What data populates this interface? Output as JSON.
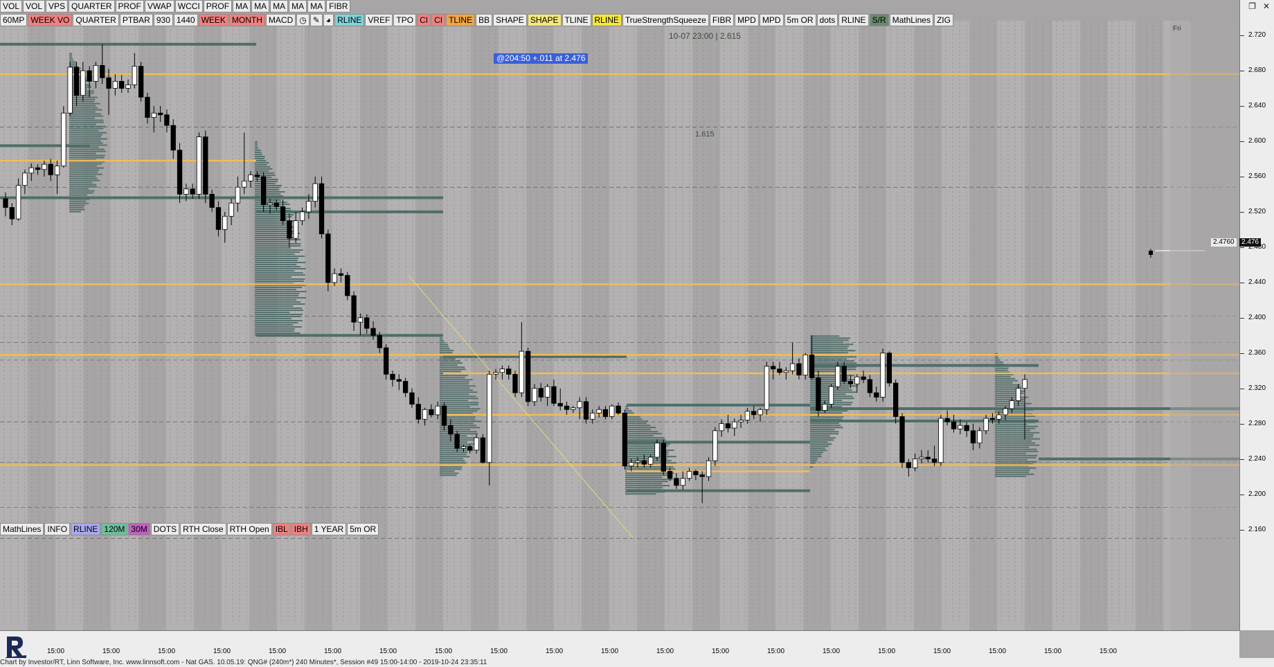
{
  "window": {
    "restore_glyph": "❐",
    "close_glyph": "✕"
  },
  "toolbar_row1": [
    "VOL",
    "VOL",
    "VPS",
    "QUARTER",
    "PROF",
    "VWAP",
    "WCCI",
    "PROF",
    "MA",
    "MA",
    "MA",
    "MA",
    "MA",
    "FIBR"
  ],
  "toolbar_row2": [
    {
      "label": "60MP",
      "color": "#ececec"
    },
    {
      "label": "WEEK VO",
      "color": "#f08080"
    },
    {
      "label": "QUARTER",
      "color": "#ececec"
    },
    {
      "label": "PTBAR",
      "color": "#ececec"
    },
    {
      "label": "930",
      "color": "#ececec"
    },
    {
      "label": "1440",
      "color": "#ececec"
    },
    {
      "label": "WEEK",
      "color": "#f08080"
    },
    {
      "label": "MONTH",
      "color": "#f08080"
    },
    {
      "label": "MACD",
      "color": "#ececec"
    },
    {
      "label": "◷",
      "color": "#ececec"
    },
    {
      "label": "✎",
      "color": "#ececec"
    },
    {
      "label": "◕",
      "color": "#ececec"
    },
    {
      "label": "RLINE",
      "color": "#7fd3d8"
    },
    {
      "label": "VREF",
      "color": "#ececec"
    },
    {
      "label": "TPO",
      "color": "#ececec"
    },
    {
      "label": "CI",
      "color": "#f08080"
    },
    {
      "label": "CI",
      "color": "#f08080"
    },
    {
      "label": "TLINE",
      "color": "#f2a640"
    },
    {
      "label": "BB",
      "color": "#ececec"
    },
    {
      "label": "SHAPE",
      "color": "#ececec"
    },
    {
      "label": "SHAPE",
      "color": "#f5e87a"
    },
    {
      "label": "TLINE",
      "color": "#ececec"
    },
    {
      "label": "RLINE",
      "color": "#f5e83a"
    },
    {
      "label": "TrueStrengthSqueeze",
      "color": "#ececec"
    },
    {
      "label": "FIBR",
      "color": "#ececec"
    },
    {
      "label": "MPD",
      "color": "#ececec"
    },
    {
      "label": "MPD",
      "color": "#ececec"
    },
    {
      "label": "5m OR",
      "color": "#ececec"
    },
    {
      "label": "dots",
      "color": "#ececec"
    },
    {
      "label": "RLINE",
      "color": "#ececec"
    },
    {
      "label": "S/R",
      "color": "#6b8a6b"
    },
    {
      "label": "MathLines",
      "color": "#ececec"
    },
    {
      "label": "ZIG",
      "color": "#ececec"
    }
  ],
  "toolbar_bottom": [
    {
      "label": "MathLines",
      "color": "#ececec"
    },
    {
      "label": "INFO",
      "color": "#ececec"
    },
    {
      "label": "RLINE",
      "color": "#a9a9f0"
    },
    {
      "label": "120M",
      "color": "#6fbf9f"
    },
    {
      "label": "30M",
      "color": "#c060c0"
    },
    {
      "label": "DOTS",
      "color": "#ececec"
    },
    {
      "label": "RTH Close",
      "color": "#ececec"
    },
    {
      "label": "RTH Open",
      "color": "#ececec"
    },
    {
      "label": "IBL",
      "color": "#f08080"
    },
    {
      "label": "IBH",
      "color": "#f08080"
    },
    {
      "label": "1 YEAR",
      "color": "#ececec"
    },
    {
      "label": "5m OR",
      "color": "#ececec"
    }
  ],
  "annotations": {
    "price_info": "@204:50  +.011 at 2.476",
    "date_label": "10-07 23:00 | 2.615",
    "fib_label": "1.615",
    "day_label": "Fri"
  },
  "price_tags": {
    "last_price": "2.476",
    "reference": "2.4760"
  },
  "y_axis_labels": [
    "2.720",
    "2.680",
    "2.640",
    "2.600",
    "2.560",
    "2.520",
    "2.480",
    "2.440",
    "2.400",
    "2.360",
    "2.320",
    "2.280",
    "2.240",
    "2.200",
    "2.160"
  ],
  "x_axis_label": "15:00",
  "status_bar": "Chart by Investor/RT, Linn Software, Inc. www.linnsoft.com - Nat GAS.   10.05.19: QNG# (240m*) 240 Minutes*, Session #49 15:00-14:00 - 2019-10-24 23:35:11",
  "colors": {
    "background": "#a7a5a5",
    "orange_level": "#f2bd55",
    "green_level": "#4f6e6b",
    "profile": "#56706d",
    "up_candle": "#ffffff",
    "down_candle": "#000000"
  },
  "chart_data": {
    "type": "candlestick",
    "instrument": "Nat GAS",
    "timeframe": "240 Minutes",
    "ylim": [
      2.14,
      2.735
    ],
    "candles": [
      [
        2.535,
        2.542,
        2.515,
        2.525
      ],
      [
        2.525,
        2.53,
        2.505,
        2.512
      ],
      [
        2.512,
        2.558,
        2.51,
        2.55
      ],
      [
        2.55,
        2.568,
        2.54,
        2.564
      ],
      [
        2.564,
        2.575,
        2.555,
        2.57
      ],
      [
        2.57,
        2.574,
        2.562,
        2.568
      ],
      [
        2.568,
        2.578,
        2.56,
        2.574
      ],
      [
        2.574,
        2.58,
        2.555,
        2.562
      ],
      [
        2.562,
        2.578,
        2.54,
        2.572
      ],
      [
        2.572,
        2.64,
        2.57,
        2.632
      ],
      [
        2.632,
        2.69,
        2.628,
        2.684
      ],
      [
        2.684,
        2.69,
        2.64,
        2.652
      ],
      [
        2.652,
        2.69,
        2.645,
        2.68
      ],
      [
        2.68,
        2.685,
        2.65,
        2.668
      ],
      [
        2.668,
        2.69,
        2.66,
        2.686
      ],
      [
        2.686,
        2.71,
        2.665,
        2.672
      ],
      [
        2.672,
        2.682,
        2.63,
        2.66
      ],
      [
        2.66,
        2.676,
        2.652,
        2.668
      ],
      [
        2.668,
        2.675,
        2.655,
        2.66
      ],
      [
        2.66,
        2.67,
        2.655,
        2.664
      ],
      [
        2.664,
        2.7,
        2.66,
        2.685
      ],
      [
        2.685,
        2.69,
        2.645,
        2.65
      ],
      [
        2.65,
        2.655,
        2.62,
        2.627
      ],
      [
        2.627,
        2.64,
        2.61,
        2.632
      ],
      [
        2.632,
        2.64,
        2.622,
        2.63
      ],
      [
        2.63,
        2.636,
        2.61,
        2.618
      ],
      [
        2.618,
        2.625,
        2.58,
        2.59
      ],
      [
        2.59,
        2.598,
        2.53,
        2.54
      ],
      [
        2.54,
        2.552,
        2.532,
        2.546
      ],
      [
        2.546,
        2.552,
        2.535,
        2.54
      ],
      [
        2.54,
        2.61,
        2.535,
        2.605
      ],
      [
        2.605,
        2.612,
        2.53,
        2.54
      ],
      [
        2.54,
        2.545,
        2.52,
        2.525
      ],
      [
        2.525,
        2.532,
        2.492,
        2.5
      ],
      [
        2.5,
        2.52,
        2.485,
        2.515
      ],
      [
        2.515,
        2.535,
        2.505,
        2.53
      ],
      [
        2.53,
        2.56,
        2.52,
        2.548
      ],
      [
        2.548,
        2.61,
        2.54,
        2.555
      ],
      [
        2.555,
        2.566,
        2.548,
        2.562
      ],
      [
        2.562,
        2.566,
        2.555,
        2.56
      ],
      [
        2.56,
        2.565,
        2.52,
        2.528
      ],
      [
        2.528,
        2.535,
        2.518,
        2.53
      ],
      [
        2.53,
        2.534,
        2.522,
        2.526
      ],
      [
        2.526,
        2.534,
        2.505,
        2.51
      ],
      [
        2.51,
        2.518,
        2.48,
        2.49
      ],
      [
        2.49,
        2.52,
        2.485,
        2.51
      ],
      [
        2.51,
        2.525,
        2.505,
        2.52
      ],
      [
        2.52,
        2.54,
        2.512,
        2.532
      ],
      [
        2.532,
        2.56,
        2.525,
        2.552
      ],
      [
        2.552,
        2.56,
        2.49,
        2.495
      ],
      [
        2.495,
        2.5,
        2.43,
        2.44
      ],
      [
        2.44,
        2.456,
        2.436,
        2.45
      ],
      [
        2.45,
        2.456,
        2.44,
        2.448
      ],
      [
        2.448,
        2.452,
        2.42,
        2.425
      ],
      [
        2.425,
        2.43,
        2.385,
        2.395
      ],
      [
        2.395,
        2.405,
        2.38,
        2.4
      ],
      [
        2.4,
        2.404,
        2.382,
        2.388
      ],
      [
        2.388,
        2.396,
        2.375,
        2.38
      ],
      [
        2.38,
        2.384,
        2.36,
        2.366
      ],
      [
        2.366,
        2.37,
        2.33,
        2.336
      ],
      [
        2.336,
        2.34,
        2.322,
        2.33
      ],
      [
        2.33,
        2.336,
        2.318,
        2.328
      ],
      [
        2.328,
        2.332,
        2.31,
        2.315
      ],
      [
        2.315,
        2.32,
        2.298,
        2.302
      ],
      [
        2.302,
        2.31,
        2.28,
        2.285
      ],
      [
        2.285,
        2.298,
        2.278,
        2.296
      ],
      [
        2.296,
        2.302,
        2.287,
        2.29
      ],
      [
        2.29,
        2.305,
        2.285,
        2.3
      ],
      [
        2.3,
        2.304,
        2.272,
        2.278
      ],
      [
        2.278,
        2.285,
        2.26,
        2.268
      ],
      [
        2.268,
        2.272,
        2.248,
        2.252
      ],
      [
        2.252,
        2.256,
        2.248,
        2.254
      ],
      [
        2.254,
        2.256,
        2.246,
        2.25
      ],
      [
        2.25,
        2.268,
        2.246,
        2.264
      ],
      [
        2.264,
        2.268,
        2.235,
        2.236
      ],
      [
        2.236,
        2.34,
        2.21,
        2.336
      ],
      [
        2.336,
        2.342,
        2.33,
        2.338
      ],
      [
        2.338,
        2.346,
        2.33,
        2.342
      ],
      [
        2.342,
        2.346,
        2.33,
        2.336
      ],
      [
        2.336,
        2.34,
        2.31,
        2.315
      ],
      [
        2.315,
        2.395,
        2.31,
        2.362
      ],
      [
        2.362,
        2.366,
        2.3,
        2.305
      ],
      [
        2.305,
        2.325,
        2.3,
        2.32
      ],
      [
        2.32,
        2.326,
        2.305,
        2.31
      ],
      [
        2.31,
        2.325,
        2.3,
        2.322
      ],
      [
        2.322,
        2.33,
        2.3,
        2.303
      ],
      [
        2.303,
        2.32,
        2.295,
        2.3
      ],
      [
        2.3,
        2.305,
        2.29,
        2.296
      ],
      [
        2.296,
        2.3,
        2.292,
        2.298
      ],
      [
        2.298,
        2.31,
        2.285,
        2.305
      ],
      [
        2.305,
        2.31,
        2.28,
        2.285
      ],
      [
        2.285,
        2.296,
        2.28,
        2.292
      ],
      [
        2.292,
        2.3,
        2.287,
        2.296
      ],
      [
        2.296,
        2.3,
        2.285,
        2.288
      ],
      [
        2.288,
        2.302,
        2.285,
        2.3
      ],
      [
        2.3,
        2.304,
        2.29,
        2.292
      ],
      [
        2.292,
        2.296,
        2.228,
        2.232
      ],
      [
        2.232,
        2.24,
        2.226,
        2.236
      ],
      [
        2.236,
        2.242,
        2.23,
        2.238
      ],
      [
        2.238,
        2.245,
        2.23,
        2.234
      ],
      [
        2.234,
        2.245,
        2.23,
        2.242
      ],
      [
        2.242,
        2.262,
        2.238,
        2.258
      ],
      [
        2.258,
        2.262,
        2.222,
        2.226
      ],
      [
        2.226,
        2.23,
        2.215,
        2.218
      ],
      [
        2.218,
        2.224,
        2.206,
        2.21
      ],
      [
        2.21,
        2.226,
        2.205,
        2.218
      ],
      [
        2.218,
        2.23,
        2.215,
        2.226
      ],
      [
        2.226,
        2.228,
        2.216,
        2.222
      ],
      [
        2.222,
        2.226,
        2.19,
        2.22
      ],
      [
        2.22,
        2.242,
        2.215,
        2.238
      ],
      [
        2.238,
        2.276,
        2.232,
        2.272
      ],
      [
        2.272,
        2.285,
        2.265,
        2.28
      ],
      [
        2.28,
        2.29,
        2.27,
        2.275
      ],
      [
        2.275,
        2.286,
        2.266,
        2.282
      ],
      [
        2.282,
        2.29,
        2.275,
        2.284
      ],
      [
        2.284,
        2.298,
        2.28,
        2.294
      ],
      [
        2.294,
        2.3,
        2.285,
        2.29
      ],
      [
        2.29,
        2.298,
        2.282,
        2.296
      ],
      [
        2.296,
        2.35,
        2.29,
        2.345
      ],
      [
        2.345,
        2.35,
        2.33,
        2.342
      ],
      [
        2.342,
        2.35,
        2.335,
        2.338
      ],
      [
        2.338,
        2.344,
        2.33,
        2.34
      ],
      [
        2.34,
        2.372,
        2.336,
        2.348
      ],
      [
        2.348,
        2.354,
        2.33,
        2.335
      ],
      [
        2.335,
        2.36,
        2.33,
        2.358
      ],
      [
        2.358,
        2.38,
        2.33,
        2.332
      ],
      [
        2.332,
        2.34,
        2.288,
        2.295
      ],
      [
        2.295,
        2.306,
        2.292,
        2.302
      ],
      [
        2.302,
        2.325,
        2.298,
        2.322
      ],
      [
        2.322,
        2.35,
        2.318,
        2.345
      ],
      [
        2.345,
        2.35,
        2.325,
        2.328
      ],
      [
        2.328,
        2.335,
        2.32,
        2.325
      ],
      [
        2.325,
        2.336,
        2.315,
        2.333
      ],
      [
        2.333,
        2.34,
        2.326,
        2.33
      ],
      [
        2.33,
        2.335,
        2.31,
        2.315
      ],
      [
        2.315,
        2.322,
        2.305,
        2.31
      ],
      [
        2.31,
        2.365,
        2.305,
        2.36
      ],
      [
        2.36,
        2.362,
        2.322,
        2.326
      ],
      [
        2.326,
        2.33,
        2.28,
        2.288
      ],
      [
        2.288,
        2.292,
        2.23,
        2.236
      ],
      [
        2.236,
        2.24,
        2.22,
        2.23
      ],
      [
        2.23,
        2.246,
        2.226,
        2.24
      ],
      [
        2.24,
        2.25,
        2.235,
        2.242
      ],
      [
        2.242,
        2.25,
        2.236,
        2.24
      ],
      [
        2.24,
        2.255,
        2.232,
        2.236
      ],
      [
        2.236,
        2.29,
        2.232,
        2.286
      ],
      [
        2.286,
        2.295,
        2.278,
        2.282
      ],
      [
        2.282,
        2.29,
        2.27,
        2.274
      ],
      [
        2.274,
        2.285,
        2.268,
        2.278
      ],
      [
        2.278,
        2.282,
        2.265,
        2.272
      ],
      [
        2.272,
        2.28,
        2.25,
        2.258
      ],
      [
        2.258,
        2.276,
        2.252,
        2.272
      ],
      [
        2.272,
        2.29,
        2.268,
        2.286
      ],
      [
        2.286,
        2.292,
        2.28,
        2.285
      ],
      [
        2.285,
        2.294,
        2.28,
        2.29
      ],
      [
        2.29,
        2.3,
        2.284,
        2.297
      ],
      [
        2.297,
        2.31,
        2.292,
        2.306
      ],
      [
        2.306,
        2.325,
        2.3,
        2.32
      ],
      [
        2.32,
        2.336,
        2.262,
        2.33
      ]
    ],
    "last_candle": [
      2.474,
      2.478,
      2.468,
      2.476
    ],
    "orange_levels": [
      2.676,
      2.578,
      2.438,
      2.358,
      2.337,
      2.29,
      2.233,
      2.226
    ],
    "green_levels": [
      2.71,
      2.595,
      2.536,
      2.52,
      2.38,
      2.356,
      2.346,
      2.301,
      2.297,
      2.283,
      2.259,
      2.24,
      2.204
    ]
  }
}
